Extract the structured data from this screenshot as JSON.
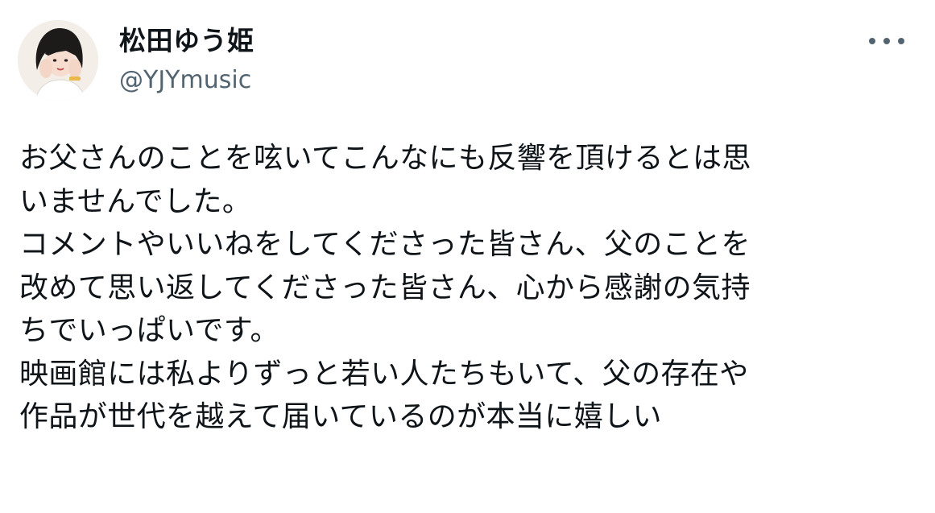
{
  "user": {
    "display_name": "松田ゆう姫",
    "handle": "@YJYmusic"
  },
  "menu": {
    "icon": "more-horizontal-icon"
  },
  "tweet": {
    "lines": [
      "お父さんのことを呟いてこんなにも反響を頂けるとは思",
      "いませんでした。",
      "コメントやいいねをしてくださった皆さん、父のことを",
      "改めて思い返してくださった皆さん、心から感謝の気持",
      "ちでいっぱいです。",
      "映画館には私よりずっと若い人たちもいて、父の存在や",
      "作品が世代を越えて届いているのが本当に嬉しい"
    ]
  },
  "colors": {
    "text": "#0f1419",
    "secondary": "#536471",
    "background": "#ffffff"
  }
}
